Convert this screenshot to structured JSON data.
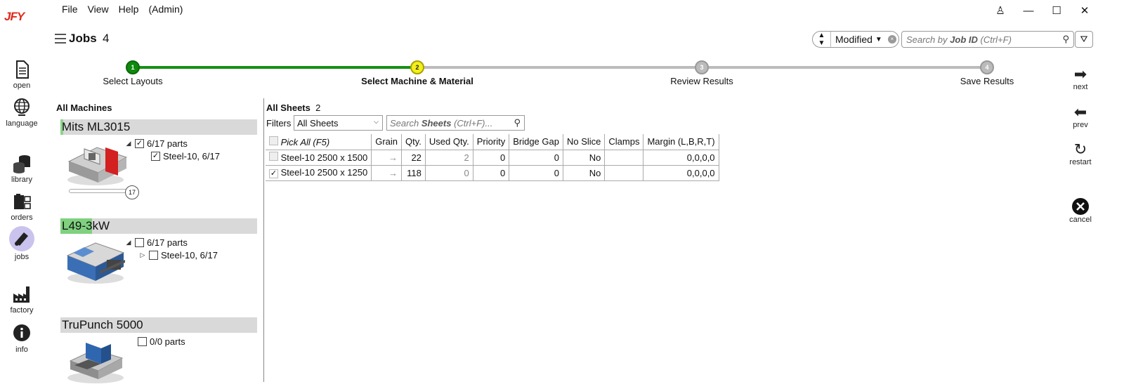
{
  "app": {
    "logo": "JFY"
  },
  "menu": [
    "File",
    "View",
    "Help",
    "(Admin)"
  ],
  "window_controls": {
    "user": "♙",
    "minimize": "—",
    "maximize": "☐",
    "close": "✕"
  },
  "rail": [
    {
      "label": "open",
      "icon": "document-icon"
    },
    {
      "label": "language",
      "icon": "globe-icon"
    },
    {
      "label": "library",
      "icon": "database-icon"
    },
    {
      "label": "orders",
      "icon": "orders-icon"
    },
    {
      "label": "jobs",
      "icon": "jobs-icon",
      "active": true
    },
    {
      "label": "factory",
      "icon": "factory-icon"
    },
    {
      "label": "info",
      "icon": "info-icon"
    }
  ],
  "header": {
    "title": "Jobs",
    "count": "4"
  },
  "sort": {
    "label": "Modified"
  },
  "search": {
    "prefix": "Search by ",
    "bold": "Job ID",
    "suffix": " (Ctrl+F)"
  },
  "steps": [
    {
      "num": "1",
      "label": "Select Layouts",
      "state": "done"
    },
    {
      "num": "2",
      "label": "Select Machine & Material",
      "state": "current"
    },
    {
      "num": "3",
      "label": "Review Results",
      "state": "todo"
    },
    {
      "num": "4",
      "label": "Save Results",
      "state": "todo"
    }
  ],
  "right_nav": {
    "next": "next",
    "prev": "prev",
    "restart": "restart",
    "cancel": "cancel"
  },
  "machines": {
    "heading": "All Machines",
    "items": [
      {
        "name": "Mits ML3015",
        "tag_color": "#8cd28c",
        "parts": "6/17 parts",
        "parts_checked": true,
        "material": "Steel-10, 6/17",
        "material_checked": true,
        "slider_value": "17"
      },
      {
        "name_tag": "L49-3",
        "name_rest": "kW",
        "tag_color": "#7fd17f",
        "parts": "6/17 parts",
        "parts_checked": false,
        "material": "Steel-10, 6/17",
        "material_checked": false
      },
      {
        "name": "TruPunch 5000",
        "parts": "0/0 parts",
        "parts_checked": false
      }
    ]
  },
  "sheets": {
    "heading": "All Sheets",
    "count": "2",
    "filters_label": "Filters",
    "filter_value": "All Sheets",
    "search": {
      "prefix": "Search ",
      "bold": "Sheets",
      "suffix": " (Ctrl+F)..."
    },
    "columns": [
      "Pick All (F5)",
      "Grain",
      "Qty.",
      "Used Qty.",
      "Priority",
      "Bridge Gap",
      "No Slice",
      "Clamps",
      "Margin (L,B,R,T)"
    ],
    "rows": [
      {
        "checked": false,
        "name": "Steel-10 2500 x 1500",
        "grain": "→",
        "qty": "22",
        "used": "2",
        "priority": "0",
        "bridge_gap": "0",
        "no_slice": "No",
        "clamps": "",
        "margin": "0,0,0,0"
      },
      {
        "checked": true,
        "name": "Steel-10 2500 x 1250",
        "grain": "→",
        "qty": "118",
        "used": "0",
        "priority": "0",
        "bridge_gap": "0",
        "no_slice": "No",
        "clamps": "",
        "margin": "0,0,0,0"
      }
    ]
  }
}
